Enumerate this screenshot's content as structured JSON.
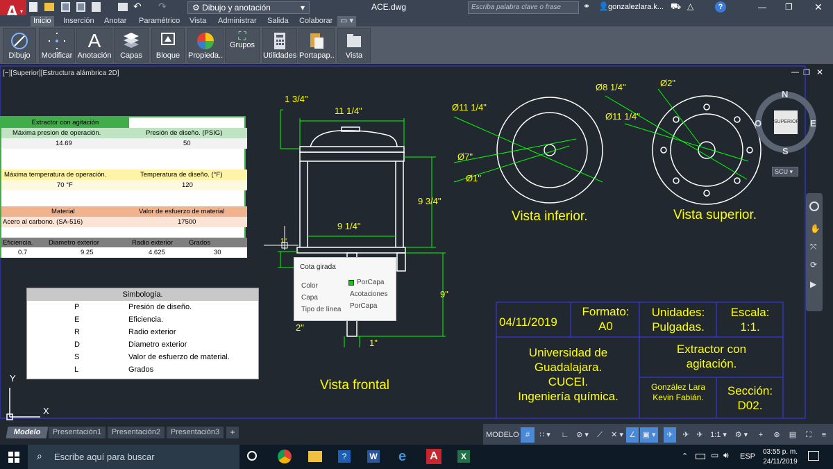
{
  "titlebar": {
    "workspace": "Dibujo y anotación",
    "filename": "ACE.dwg",
    "search_placeholder": "Escriba palabra clave o frase",
    "user": "gonzalezlara.k..."
  },
  "ribbon_tabs": [
    "Inicio",
    "Inserción",
    "Anotar",
    "Paramétrico",
    "Vista",
    "Administrar",
    "Salida",
    "Colaborar"
  ],
  "ribbon_buttons": [
    "Dibujo",
    "Modificar",
    "Anotación",
    "Capas",
    "Bloque",
    "Propieda...",
    "Grupos",
    "Utilidades",
    "Portapap...",
    "Vista"
  ],
  "viewport_label": "[−][Superior][Estructura alámbrica 2D]",
  "viewcube": {
    "n": "N",
    "s": "S",
    "o": "O",
    "e": "E",
    "face": "SUPERIOR",
    "scu": "SCU"
  },
  "spreadsheet": {
    "title": "Extractor con agitación",
    "row1_headers": [
      "Máxima presion de operación.",
      "Presión de diseño. (PSIG)"
    ],
    "row1_values": [
      "14.69",
      "50"
    ],
    "row2_headers": [
      "Máxima temperatura de operación.",
      "Temperatura de diseño. (°F)"
    ],
    "row2_values": [
      "70 °F",
      "120"
    ],
    "row3_headers": [
      "Material",
      "Valor de esfuerzo de material"
    ],
    "row3_values": [
      "Acero al carbono. (SA-516)",
      "17500"
    ],
    "row4_headers": [
      "Eficiencia.",
      "Diametro exterior",
      "Radio exterior",
      "Grados"
    ],
    "row4_values": [
      "0.7",
      "9.25",
      "4.625",
      "30"
    ]
  },
  "symbology": {
    "title": "Simbología.",
    "rows": [
      {
        "sym": "P",
        "desc": "Presión de diseño."
      },
      {
        "sym": "E",
        "desc": "Eficiencia."
      },
      {
        "sym": "R",
        "desc": "Radio exterior"
      },
      {
        "sym": "D",
        "desc": "Diametro exterior"
      },
      {
        "sym": "S",
        "desc": "Valor de esfuerzo de material."
      },
      {
        "sym": "L",
        "desc": "Grados"
      }
    ]
  },
  "dimensions": {
    "d1": "1 3/4\"",
    "d2": "11 1/4\"",
    "d3": "9 3/4\"",
    "d4": "9 1/4\"",
    "d5": "9\"",
    "d6": "2\"",
    "d7": "1\"",
    "d8": "1\"",
    "d9": "Ø11 1/4\"",
    "d10": "Ø7\"",
    "d11": "Ø1\"",
    "d12": "Ø8 1/4\"",
    "d13": "Ø2\"",
    "d14": "Ø11 1/4\""
  },
  "view_labels": {
    "front": "Vista frontal",
    "bottom": "Vista inferior.",
    "top": "Vista superior."
  },
  "tooltip": {
    "title": "Cota girada",
    "rows": [
      {
        "k": "Color",
        "v": "PorCapa"
      },
      {
        "k": "Capa",
        "v": "Acotaciones"
      },
      {
        "k": "Tipo de línea",
        "v": "PorCapa"
      }
    ]
  },
  "title_block": {
    "date": "04/11/2019",
    "formato_label": "Formato:",
    "formato_value": "A0",
    "unidades_label": "Unidades:",
    "unidades_value": "Pulgadas.",
    "escala_label": "Escala:",
    "escala_value": "1:1.",
    "uni_1": "Universidad de",
    "uni_2": "Guadalajara.",
    "uni_3": "CUCEI.",
    "uni_4": "Ingeniería química.",
    "project_1": "Extractor con",
    "project_2": "agitación.",
    "author_1": "González Lara",
    "author_2": "Kevin Fabián.",
    "section_label": "Sección:",
    "section_value": "D02."
  },
  "ucs": {
    "x": "X",
    "y": "Y"
  },
  "layout_tabs": [
    "Modelo",
    "Presentación1",
    "Presentación2",
    "Presentación3"
  ],
  "status": {
    "model": "MODELO",
    "scale": "1:1"
  },
  "taskbar": {
    "search_placeholder": "Escribe aquí para buscar",
    "lang": "ESP",
    "time": "03:55 p. m.",
    "date": "24/11/2019"
  },
  "colors": {
    "accent_green": "#00ff00",
    "yellow": "#ffff00",
    "frame_blue": "#3a3aff",
    "bg": "#212830"
  }
}
